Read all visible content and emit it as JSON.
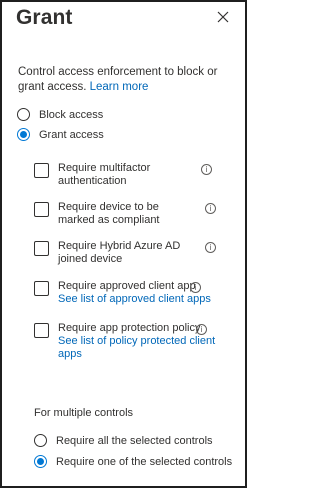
{
  "header": {
    "title": "Grant",
    "close_icon": "close-icon"
  },
  "description": {
    "text": "Control access enforcement to block or grant access.",
    "link": "Learn more"
  },
  "access_options": [
    {
      "label": "Block access",
      "selected": false
    },
    {
      "label": "Grant access",
      "selected": true
    }
  ],
  "controls": [
    {
      "label": "Require multifactor authentication",
      "link": "",
      "checked": false
    },
    {
      "label": "Require device to be marked as compliant",
      "link": "",
      "checked": false
    },
    {
      "label": "Require Hybrid Azure AD joined device",
      "link": "",
      "checked": false
    },
    {
      "label": "Require approved client app",
      "link": "See list of approved client apps",
      "checked": false
    },
    {
      "label": "Require app protection policy",
      "link": "See list of policy protected client apps",
      "checked": false
    }
  ],
  "multiple_controls": {
    "label": "For multiple controls",
    "options": [
      {
        "label": "Require all the selected controls",
        "selected": false
      },
      {
        "label": "Require one of the selected controls",
        "selected": true
      }
    ]
  },
  "colors": {
    "accent": "#0078d4",
    "link": "#0067b8",
    "text": "#323130"
  }
}
